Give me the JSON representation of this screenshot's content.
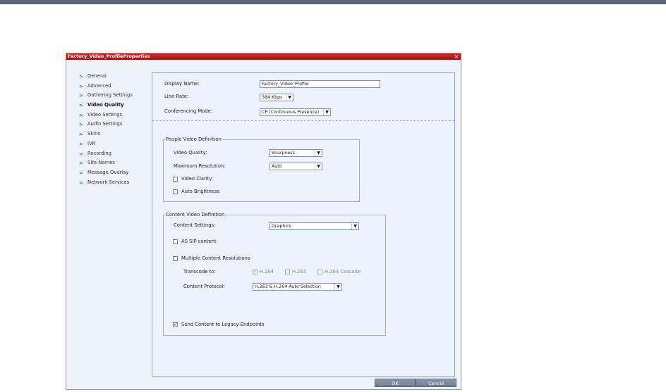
{
  "window": {
    "title": "Factory_Video_ProfileProperties",
    "close_glyph": "×"
  },
  "nav": {
    "arrow_glyph": ">",
    "items": [
      {
        "label": "General",
        "active": false
      },
      {
        "label": "Advanced",
        "active": false
      },
      {
        "label": "Gathering Settings",
        "active": false
      },
      {
        "label": "Video Quality",
        "active": true
      },
      {
        "label": "Video Settings",
        "active": false
      },
      {
        "label": "Audio Settings",
        "active": false
      },
      {
        "label": "Skins",
        "active": false
      },
      {
        "label": "IVR",
        "active": false
      },
      {
        "label": "Recording",
        "active": false
      },
      {
        "label": "Site Names",
        "active": false
      },
      {
        "label": "Message Overlay",
        "active": false
      },
      {
        "label": "Network Services",
        "active": false
      }
    ]
  },
  "general": {
    "display_name_label": "Display Name:",
    "display_name_value": "Factory_Video_Profile",
    "line_rate_label": "Line Rate:",
    "line_rate_value": "384 Kbps",
    "conferencing_mode_label": "Conferencing Mode:",
    "conferencing_mode_value": "CP (Continuous Presence)"
  },
  "people_video": {
    "title": "People Video Definition",
    "video_quality_label": "Video Quality:",
    "video_quality_value": "Sharpness",
    "max_resolution_label": "Maximum Resolution:",
    "max_resolution_value": "Auto",
    "video_clarity_label": "Video Clarity",
    "video_clarity_checked": false,
    "auto_brightness_label": "Auto Brightness",
    "auto_brightness_checked": false
  },
  "content_video": {
    "title": "Content Video Definition",
    "content_settings_label": "Content Settings:",
    "content_settings_value": "Graphics",
    "as_sip_label": "AS SIP content",
    "as_sip_checked": false,
    "multiple_resolutions_label": "Multiple Content Resolutions",
    "multiple_resolutions_checked": false,
    "transcode_label": "Transcode to:",
    "transcode_h264_label": "H.264",
    "transcode_h264_checked": true,
    "transcode_h263_label": "H.263",
    "transcode_h263_checked": false,
    "transcode_cascade_label": "H.264 Cascade",
    "transcode_cascade_checked": false,
    "content_protocol_label": "Content Protocol:",
    "content_protocol_value": "H.263 & H.264 Auto Selection",
    "send_legacy_label": "Send Content to Legacy Endpoints",
    "send_legacy_checked": true
  },
  "footer": {
    "ok_label": "OK",
    "cancel_label": "Cancel"
  },
  "glyphs": {
    "dropdown": "▼",
    "check": "✓"
  },
  "colors": {
    "title_bar": "#c42020",
    "nav_arrow": "#3a78c8",
    "button": "#7f8a9e"
  }
}
